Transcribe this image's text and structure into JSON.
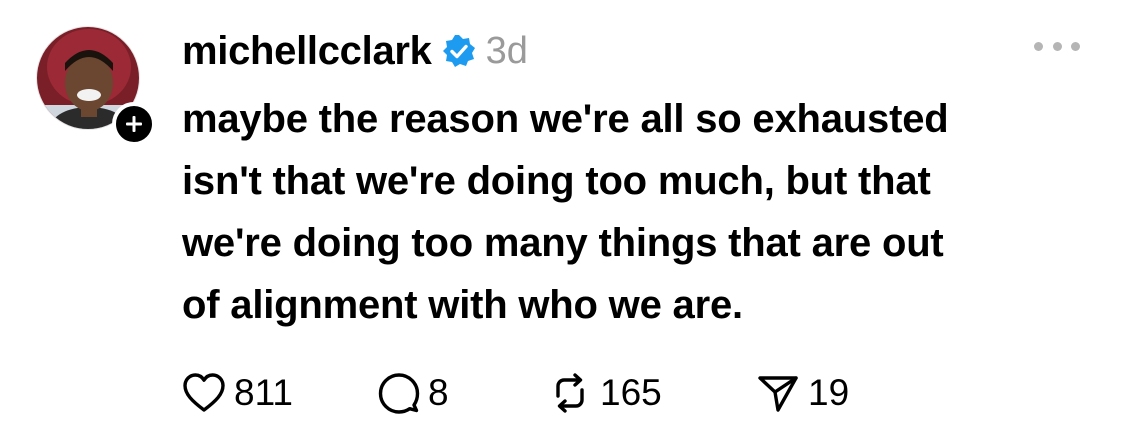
{
  "post": {
    "username": "michellcclark",
    "timestamp": "3d",
    "verified": true,
    "avatar_icon": "profile-photo",
    "follow_icon": "plus-icon",
    "more_icon": "ellipsis-icon",
    "text_lines": [
      "maybe the reason we're all so exhausted",
      "isn't that we're doing too much, but that",
      "we're doing too many things that are out",
      "of alignment with who we are."
    ],
    "actions": {
      "likes": "811",
      "replies": "8",
      "reposts": "165",
      "shares": "19"
    }
  },
  "colors": {
    "text": "#000000",
    "muted": "#9a9a9a",
    "verified_blue": "#1d9bf0",
    "more_dots": "#b5b5b5"
  }
}
